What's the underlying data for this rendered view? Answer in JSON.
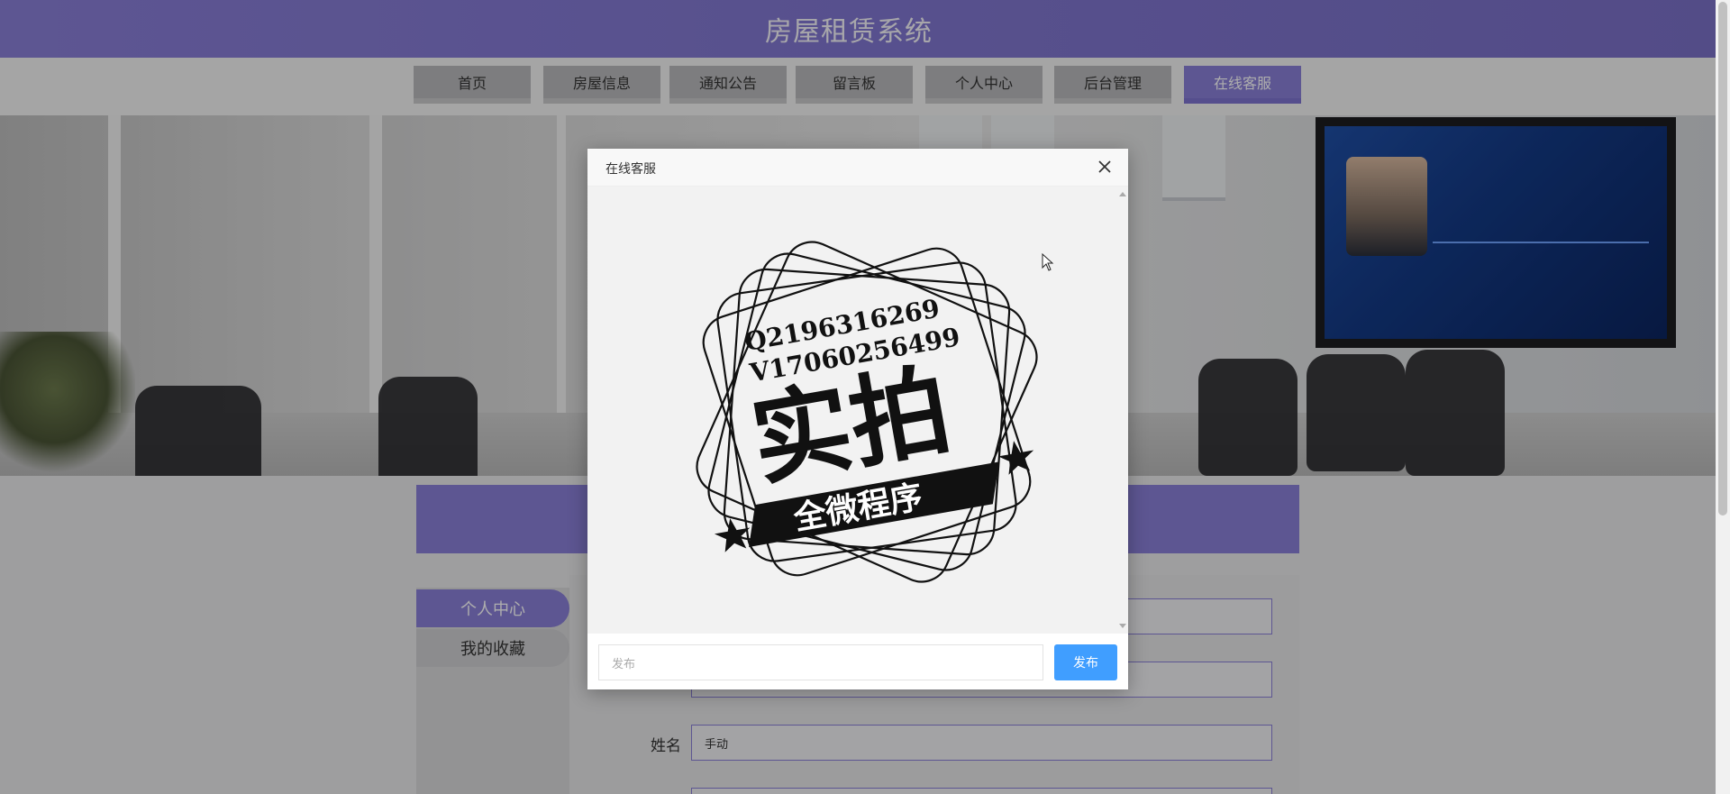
{
  "header": {
    "title": "房屋租赁系统"
  },
  "nav": {
    "items": [
      {
        "label": "首页"
      },
      {
        "label": "房屋信息"
      },
      {
        "label": "通知公告"
      },
      {
        "label": "留言板"
      },
      {
        "label": "个人中心"
      },
      {
        "label": "后台管理"
      },
      {
        "label": "在线客服",
        "active": true
      }
    ]
  },
  "sidebar": {
    "items": [
      {
        "label": "个人中心",
        "active": true
      },
      {
        "label": "我的收藏"
      }
    ]
  },
  "form": {
    "name_label": "姓名",
    "name_value": "手动"
  },
  "dialog": {
    "title": "在线客服",
    "close_icon": "close-icon",
    "stamp_text": {
      "line1": "Q2196316269",
      "line2": "V17060256499",
      "big": "实拍",
      "banner": "全微程序"
    },
    "input_placeholder": "发布",
    "send_label": "发布"
  },
  "colors": {
    "accent": "#8a7fd8",
    "button_blue": "#409eff"
  }
}
